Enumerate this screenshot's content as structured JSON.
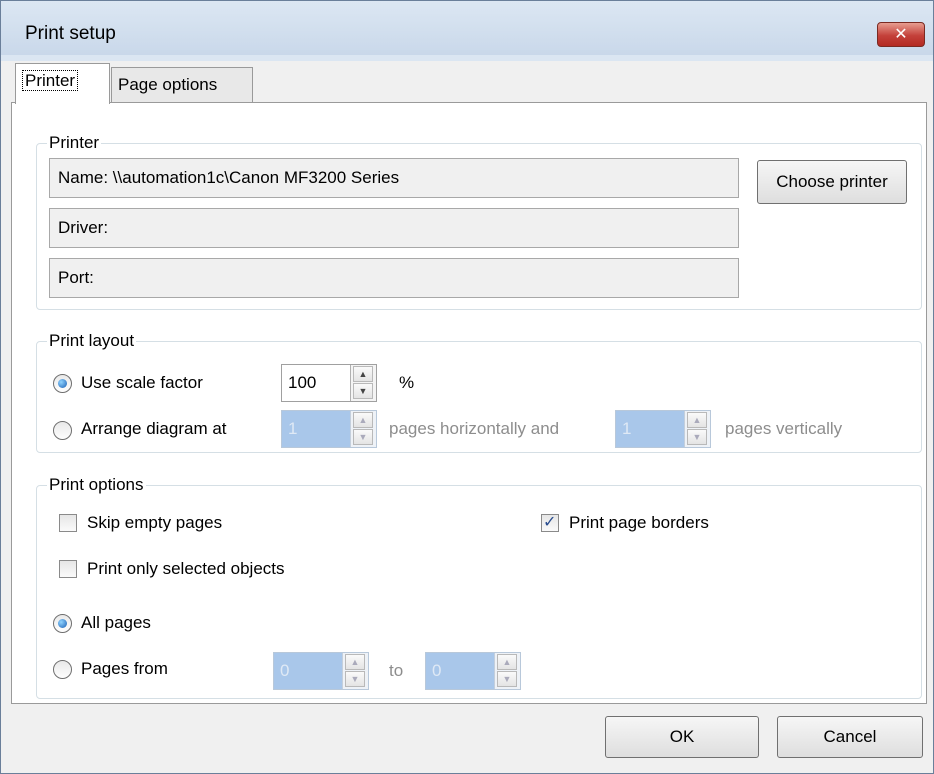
{
  "window": {
    "title": "Print setup",
    "close_glyph": "✕"
  },
  "tabs": [
    {
      "label": "Printer",
      "active": true
    },
    {
      "label": "Page options",
      "active": false
    }
  ],
  "printer_group": {
    "title": "Printer",
    "name": "Name: \\\\automation1c\\Canon MF3200 Series",
    "driver": "Driver:",
    "port": "Port:",
    "choose_button": "Choose printer"
  },
  "layout_group": {
    "title": "Print layout",
    "scale_option": {
      "label": "Use scale factor",
      "selected": true,
      "value": "100",
      "unit": "%"
    },
    "arrange_option": {
      "label": "Arrange diagram at",
      "selected": false,
      "horizontal_value": "1",
      "horizontal_label": "pages horizontally and",
      "vertical_value": "1",
      "vertical_label": "pages vertically"
    }
  },
  "options_group": {
    "title": "Print options",
    "skip_empty": {
      "label": "Skip empty pages",
      "checked": false
    },
    "print_borders": {
      "label": "Print page borders",
      "checked": true
    },
    "selected_only": {
      "label": "Print only selected objects",
      "checked": false
    },
    "all_pages": {
      "label": "All pages",
      "selected": true
    },
    "pages_from": {
      "label": "Pages from",
      "selected": false,
      "from_value": "0",
      "to_label": "to",
      "to_value": "0"
    }
  },
  "buttons": {
    "ok": "OK",
    "cancel": "Cancel"
  },
  "colors": {
    "accent": "#1a5fb4",
    "close_button": "#c4413a",
    "disabled_spin": "#a9c7ea"
  }
}
